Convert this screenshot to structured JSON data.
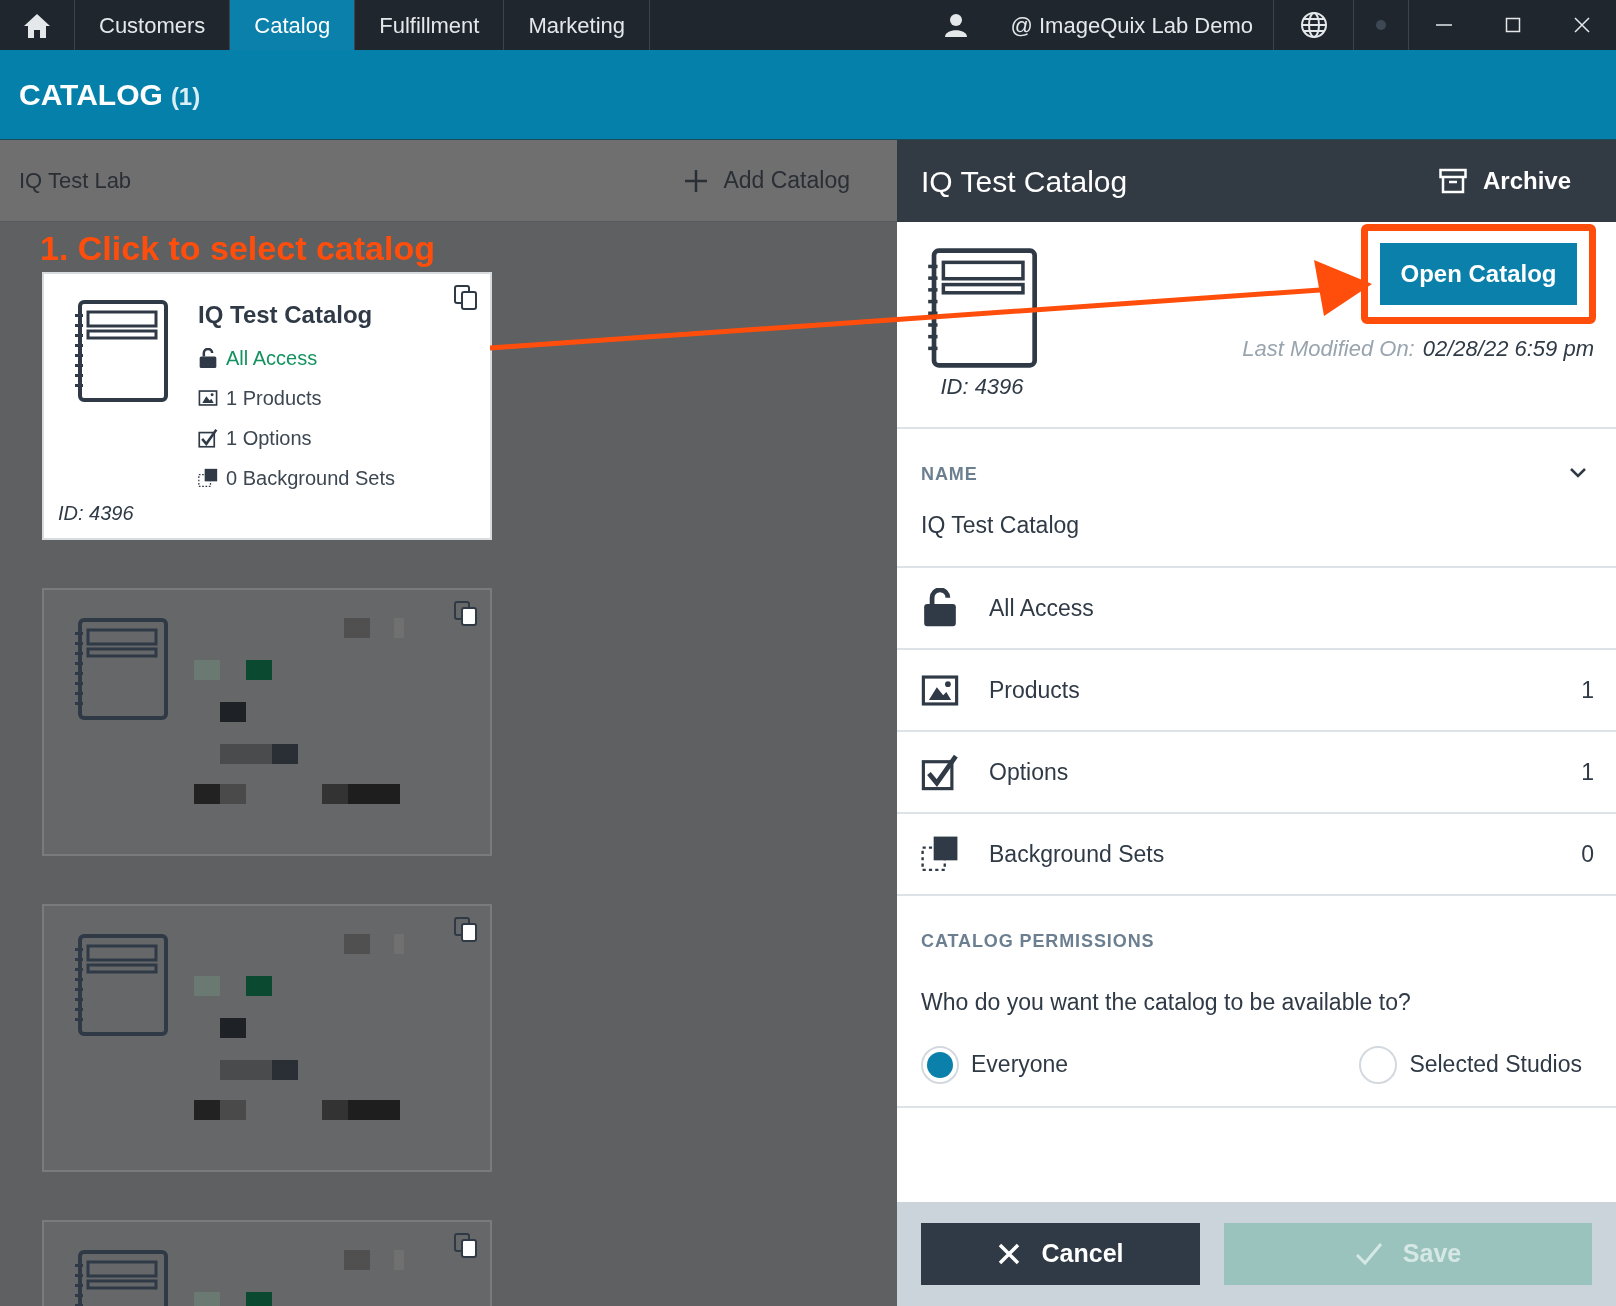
{
  "top_bar": {
    "tabs": [
      {
        "label": "Customers",
        "selected": false
      },
      {
        "label": "Catalog",
        "selected": true
      },
      {
        "label": "Fulfillment",
        "selected": false
      },
      {
        "label": "Marketing",
        "selected": false
      }
    ],
    "account": "@ ImageQuix Lab Demo"
  },
  "page_header": {
    "title": "CATALOG",
    "count": "(1)"
  },
  "left_panel": {
    "lab_name": "IQ Test Lab",
    "add_button": "Add Catalog",
    "annotation": "1. Click to select catalog",
    "selected_card": {
      "title": "IQ Test Catalog",
      "id": "ID: 4396",
      "stats": [
        {
          "kind": "access",
          "text": "All Access"
        },
        {
          "kind": "products",
          "text": "1 Products"
        },
        {
          "kind": "options",
          "text": "1 Options"
        },
        {
          "kind": "backgrounds",
          "text": "0 Background Sets"
        }
      ]
    },
    "other_cards": [
      {
        "kind": "blurred"
      },
      {
        "kind": "blurred"
      },
      {
        "kind": "blurred"
      }
    ]
  },
  "detail_panel": {
    "title": "IQ Test Catalog",
    "archive_button": "Archive",
    "id": "ID: 4396",
    "open_button": "Open Catalog",
    "modified_label": "Last Modified On:",
    "modified_value": "02/28/22 6:59 pm",
    "name_section": {
      "label": "NAME",
      "value": "IQ Test Catalog",
      "expanded": true
    },
    "rows": [
      {
        "kind": "access",
        "label": "All Access"
      },
      {
        "kind": "products",
        "label": "Products",
        "count": "1"
      },
      {
        "kind": "options",
        "label": "Options",
        "count": "1"
      },
      {
        "kind": "backgrounds",
        "label": "Background Sets",
        "count": "0"
      }
    ],
    "permissions": {
      "heading": "CATALOG PERMISSIONS",
      "question": "Who do you want the catalog to be available to?",
      "choices": [
        {
          "label": "Everyone",
          "selected": true
        },
        {
          "label": "Selected Studios",
          "selected": false
        }
      ]
    },
    "footer": {
      "cancel": "Cancel",
      "save": "Save",
      "save_disabled": true
    }
  }
}
